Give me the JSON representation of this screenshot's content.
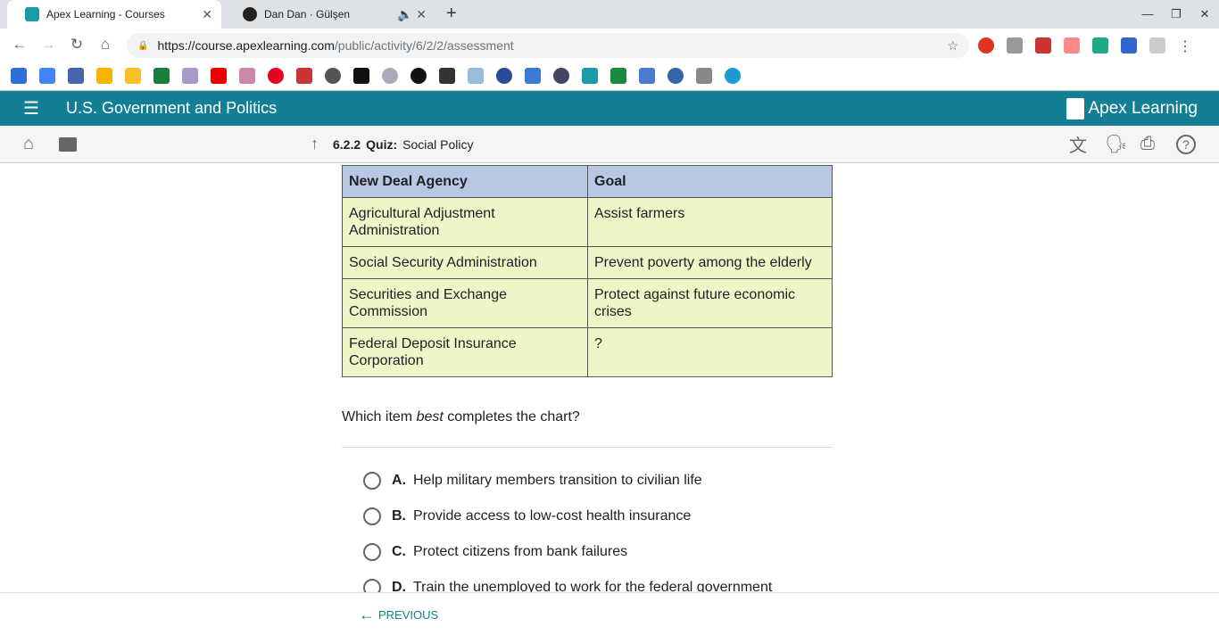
{
  "browser": {
    "tabs": [
      {
        "title": "Apex Learning - Courses"
      },
      {
        "title": "Dan Dan · Gülşen"
      }
    ],
    "url_host": "https://course.apexlearning.com",
    "url_path": "/public/activity/6/2/2/assessment"
  },
  "header": {
    "course_title": "U.S. Government and Politics",
    "logo": "Apex Learning"
  },
  "breadcrumb": {
    "number": "6.2.2",
    "type": "Quiz:",
    "title": "Social Policy"
  },
  "table": {
    "headers": [
      "New Deal Agency",
      "Goal"
    ],
    "rows": [
      [
        "Agricultural Adjustment Administration",
        "Assist farmers"
      ],
      [
        "Social Security Administration",
        "Prevent poverty among the elderly"
      ],
      [
        "Securities and Exchange Commission",
        "Protect against future economic crises"
      ],
      [
        "Federal Deposit Insurance Corporation",
        "?"
      ]
    ]
  },
  "question": {
    "before": "Which item ",
    "emph": "best",
    "after": " completes the chart?"
  },
  "options": [
    {
      "letter": "A.",
      "text": "Help military members transition to civilian life"
    },
    {
      "letter": "B.",
      "text": "Provide access to low-cost health insurance"
    },
    {
      "letter": "C.",
      "text": "Protect citizens from bank failures"
    },
    {
      "letter": "D.",
      "text": "Train the unemployed to work for the federal government"
    }
  ],
  "footer": {
    "previous": "PREVIOUS"
  },
  "colors": {
    "brand": "#137f95",
    "table_header": "#b8c8e4",
    "table_cell": "#eef5c6"
  }
}
